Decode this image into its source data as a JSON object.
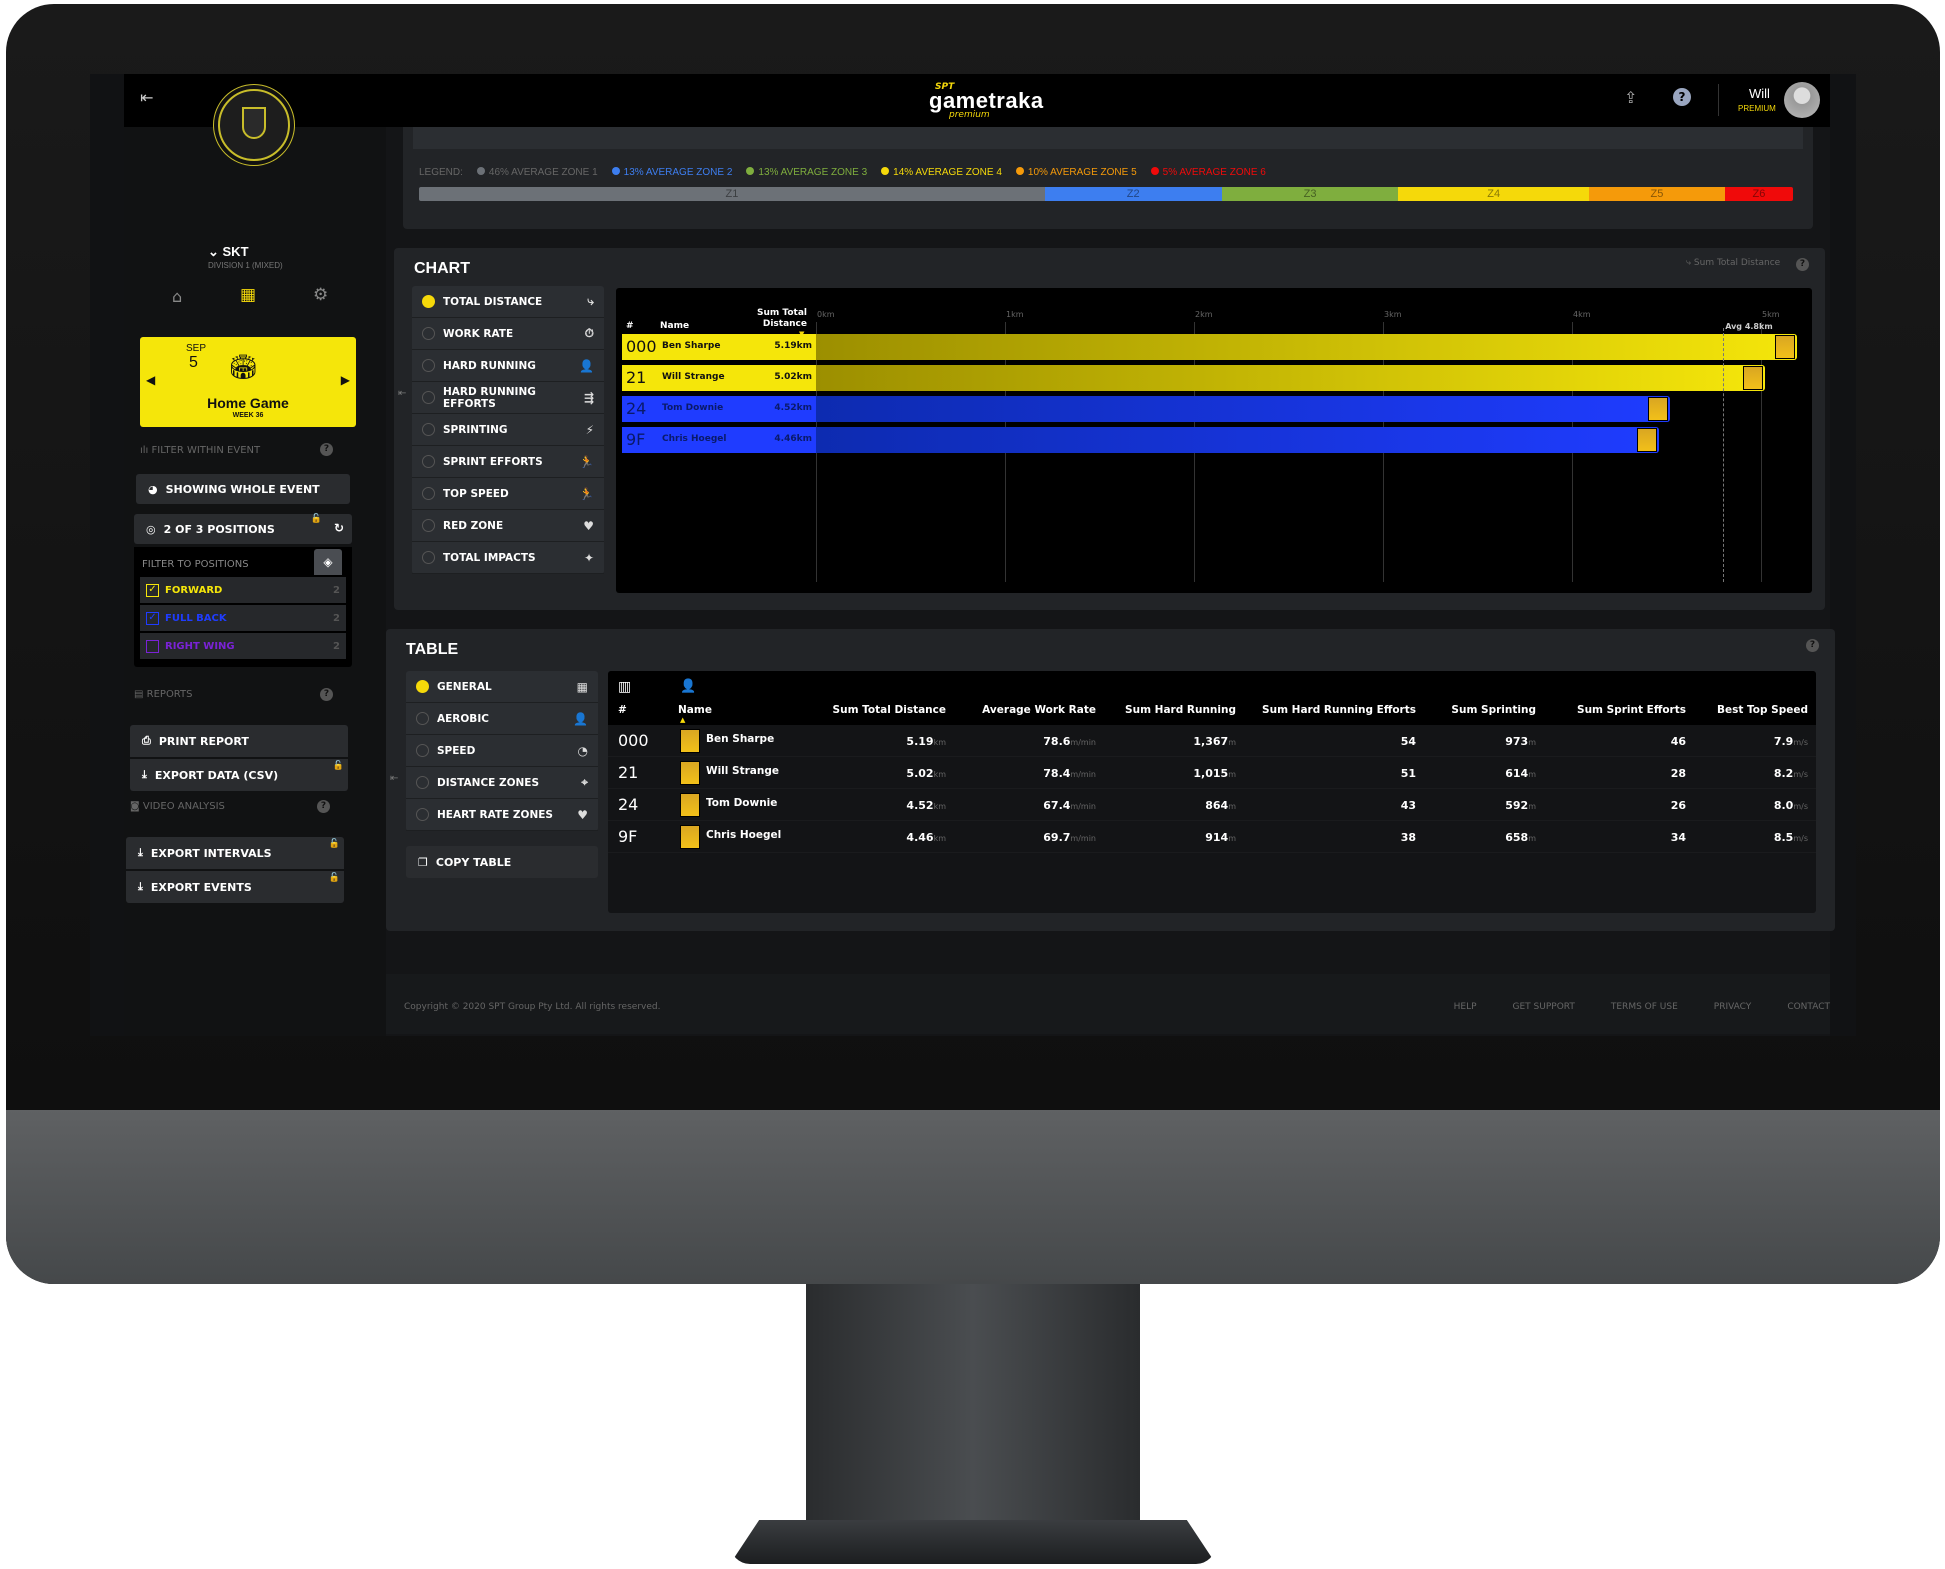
{
  "header": {
    "logo_top": "SPT",
    "logo_main": "gametraka",
    "logo_sub": "premium",
    "user_name": "Will",
    "user_tier": "PREMIUM"
  },
  "sidebar": {
    "team": "SKT",
    "division": "DIVISION 1 (MIXED)",
    "event": {
      "month": "SEP",
      "day": "5",
      "title": "Home Game",
      "week": "WEEK 36"
    },
    "filter_within_event": "FILTER WITHIN EVENT",
    "showing_whole_event": "SHOWING WHOLE EVENT",
    "positions_summary": "2 OF 3 POSITIONS",
    "filter_to_positions": "FILTER TO POSITIONS",
    "positions": [
      {
        "label": "FORWARD",
        "count": "2",
        "checked": true,
        "color": "#f5e60a"
      },
      {
        "label": "FULL BACK",
        "count": "2",
        "checked": true,
        "color": "#1f3cff"
      },
      {
        "label": "RIGHT WING",
        "count": "2",
        "checked": false,
        "color": "#7a22d6"
      }
    ],
    "reports_label": "REPORTS",
    "print_report": "PRINT REPORT",
    "export_csv": "EXPORT DATA (CSV)",
    "video_label": "VIDEO ANALYSIS",
    "export_intervals": "EXPORT INTERVALS",
    "export_events": "EXPORT EVENTS"
  },
  "zones": {
    "legend_label": "LEGEND:",
    "items": [
      {
        "label": "46% AVERAGE ZONE 1",
        "pct": 46,
        "short": "Z1",
        "color": "#6c7177"
      },
      {
        "label": "13% AVERAGE ZONE 2",
        "pct": 13,
        "short": "Z2",
        "color": "#3d7ef0"
      },
      {
        "label": "13% AVERAGE ZONE 3",
        "pct": 13,
        "short": "Z3",
        "color": "#7fae3e"
      },
      {
        "label": "14% AVERAGE ZONE 4",
        "pct": 14,
        "short": "Z4",
        "color": "#f5d90a"
      },
      {
        "label": "10% AVERAGE ZONE 5",
        "pct": 10,
        "short": "Z5",
        "color": "#f59a0a"
      },
      {
        "label": "5% AVERAGE ZONE 6",
        "pct": 5,
        "short": "Z6",
        "color": "#f00a0a"
      }
    ]
  },
  "chart": {
    "title": "CHART",
    "metric_label": "Sum Total Distance",
    "options": [
      {
        "label": "TOTAL DISTANCE",
        "icon": "route-icon",
        "on": true
      },
      {
        "label": "WORK RATE",
        "icon": "stopwatch-icon"
      },
      {
        "label": "HARD RUNNING",
        "icon": "person-icon"
      },
      {
        "label": "HARD RUNNING EFFORTS",
        "icon": "runner-fast-icon"
      },
      {
        "label": "SPRINTING",
        "icon": "sprinter-icon"
      },
      {
        "label": "SPRINT EFFORTS",
        "icon": "runner-icon"
      },
      {
        "label": "TOP SPEED",
        "icon": "runner-icon"
      },
      {
        "label": "RED ZONE",
        "icon": "heart-icon"
      },
      {
        "label": "TOTAL IMPACTS",
        "icon": "impact-icon"
      }
    ]
  },
  "chart_data": {
    "type": "bar",
    "orientation": "horizontal",
    "col_headers": {
      "num": "#",
      "name": "Name",
      "value": "Sum Total Distance"
    },
    "x_ticks": [
      "0km",
      "1km",
      "2km",
      "3km",
      "4km",
      "5km"
    ],
    "xlim": [
      0,
      5.1
    ],
    "average": {
      "label": "Avg 4.8km",
      "value": 4.8
    },
    "rows": [
      {
        "num": "000",
        "name": "Ben Sharpe",
        "value": 5.19,
        "label": "5.19km",
        "color": "#f5e60a"
      },
      {
        "num": "21",
        "name": "Will Strange",
        "value": 5.02,
        "label": "5.02km",
        "color": "#f5e60a"
      },
      {
        "num": "24",
        "name": "Tom Downie",
        "value": 4.52,
        "label": "4.52km",
        "color": "#1f3cff"
      },
      {
        "num": "9F",
        "name": "Chris Hoegel",
        "value": 4.46,
        "label": "4.46km",
        "color": "#1f3cff"
      }
    ]
  },
  "table": {
    "title": "TABLE",
    "options": [
      {
        "label": "GENERAL",
        "icon": "grid-icon",
        "on": true
      },
      {
        "label": "AEROBIC",
        "icon": "person-icon"
      },
      {
        "label": "SPEED",
        "icon": "speedometer-icon"
      },
      {
        "label": "DISTANCE ZONES",
        "icon": "crosshair-icon"
      },
      {
        "label": "HEART RATE ZONES",
        "icon": "heart-icon"
      }
    ],
    "copy_table": "COPY TABLE",
    "columns": [
      "#",
      "Name",
      "Sum Total Distance",
      "Average Work Rate",
      "Sum Hard Running",
      "Sum Hard Running Efforts",
      "Sum Sprinting",
      "Sum Sprint Efforts",
      "Best Top Speed"
    ],
    "rows": [
      {
        "num": "000",
        "name": "Ben Sharpe",
        "cells": [
          [
            "5.19",
            "km"
          ],
          [
            "78.6",
            "m/min"
          ],
          [
            "1,367",
            "m"
          ],
          [
            "54",
            ""
          ],
          [
            "973",
            "m"
          ],
          [
            "46",
            ""
          ],
          [
            "7.9",
            "m/s"
          ]
        ]
      },
      {
        "num": "21",
        "name": "Will Strange",
        "cells": [
          [
            "5.02",
            "km"
          ],
          [
            "78.4",
            "m/min"
          ],
          [
            "1,015",
            "m"
          ],
          [
            "51",
            ""
          ],
          [
            "614",
            "m"
          ],
          [
            "28",
            ""
          ],
          [
            "8.2",
            "m/s"
          ]
        ]
      },
      {
        "num": "24",
        "name": "Tom Downie",
        "cells": [
          [
            "4.52",
            "km"
          ],
          [
            "67.4",
            "m/min"
          ],
          [
            "864",
            "m"
          ],
          [
            "43",
            ""
          ],
          [
            "592",
            "m"
          ],
          [
            "26",
            ""
          ],
          [
            "8.0",
            "m/s"
          ]
        ]
      },
      {
        "num": "9F",
        "name": "Chris Hoegel",
        "cells": [
          [
            "4.46",
            "km"
          ],
          [
            "69.7",
            "m/min"
          ],
          [
            "914",
            "m"
          ],
          [
            "38",
            ""
          ],
          [
            "658",
            "m"
          ],
          [
            "34",
            ""
          ],
          [
            "8.5",
            "m/s"
          ]
        ]
      }
    ]
  },
  "footer": {
    "copyright": "Copyright © 2020 SPT Group Pty Ltd. All rights reserved.",
    "links": [
      "HELP",
      "GET SUPPORT",
      "TERMS OF USE",
      "PRIVACY",
      "CONTACT"
    ]
  }
}
